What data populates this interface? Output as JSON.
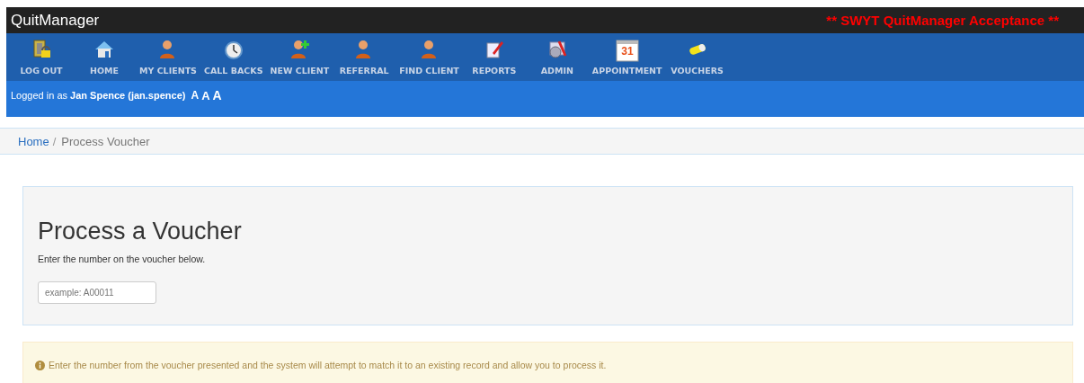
{
  "header": {
    "brand": "QuitManager",
    "environment": "** SWYT QuitManager Acceptance **"
  },
  "nav": [
    {
      "label": "LOG OUT"
    },
    {
      "label": "HOME"
    },
    {
      "label": "MY CLIENTS"
    },
    {
      "label": "CALL BACKS"
    },
    {
      "label": "NEW CLIENT"
    },
    {
      "label": "REFERRAL"
    },
    {
      "label": "FIND CLIENT"
    },
    {
      "label": "REPORTS"
    },
    {
      "label": "ADMIN"
    },
    {
      "label": "APPOINTMENT",
      "icon_text": "31"
    },
    {
      "label": "VOUCHERS"
    }
  ],
  "user_bar": {
    "prefix": "Logged in as",
    "user": "Jan Spence (jan.spence)",
    "font_sizes": [
      "A",
      "A",
      "A"
    ]
  },
  "breadcrumb": {
    "separator": "/",
    "items": [
      {
        "label": "Home",
        "link": true
      },
      {
        "label": "Process Voucher",
        "link": false
      }
    ]
  },
  "panel": {
    "title": "Process a Voucher",
    "instruction": "Enter the number on the voucher below.",
    "voucher_field": {
      "placeholder": "example: A00011"
    }
  },
  "alert": {
    "text": "Enter the number from the voucher presented and the system will attempt to match it to an existing record and allow you to process it."
  }
}
